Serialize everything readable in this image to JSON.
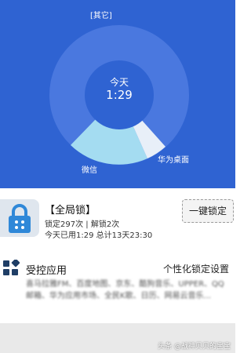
{
  "usage_chart": {
    "center_label": "今天",
    "center_value": "1:29",
    "segments": [
      {
        "label": "[其它]",
        "color": "#4a78df"
      },
      {
        "label": "微信",
        "color": "#a4dcf1"
      },
      {
        "label": "华为桌面",
        "color": "#e8eff8"
      }
    ]
  },
  "global_lock": {
    "title": "【全局锁】",
    "stats": "锁定297次 | 解锁2次",
    "usage": "今天已用1:29 总计13天23:30",
    "button_label": "一键锁定"
  },
  "controlled_apps": {
    "title": "受控应用",
    "settings_link": "个性化锁定设置",
    "list_text": "喜马拉雅FM、百度地图、京东、酷狗音乐、UPPER、QQ邮箱、华为应用市场、全民K歌、日历、网易云音乐..."
  },
  "watermark": "头条 @战神贝贝的宝宝",
  "colors": {
    "primary_blue": "#2f63d2",
    "donut_ring": "#4a78df",
    "wechat_segment": "#a4dcf1",
    "huawei_segment": "#e8eff8",
    "lock_icon": "#2f88d8"
  }
}
